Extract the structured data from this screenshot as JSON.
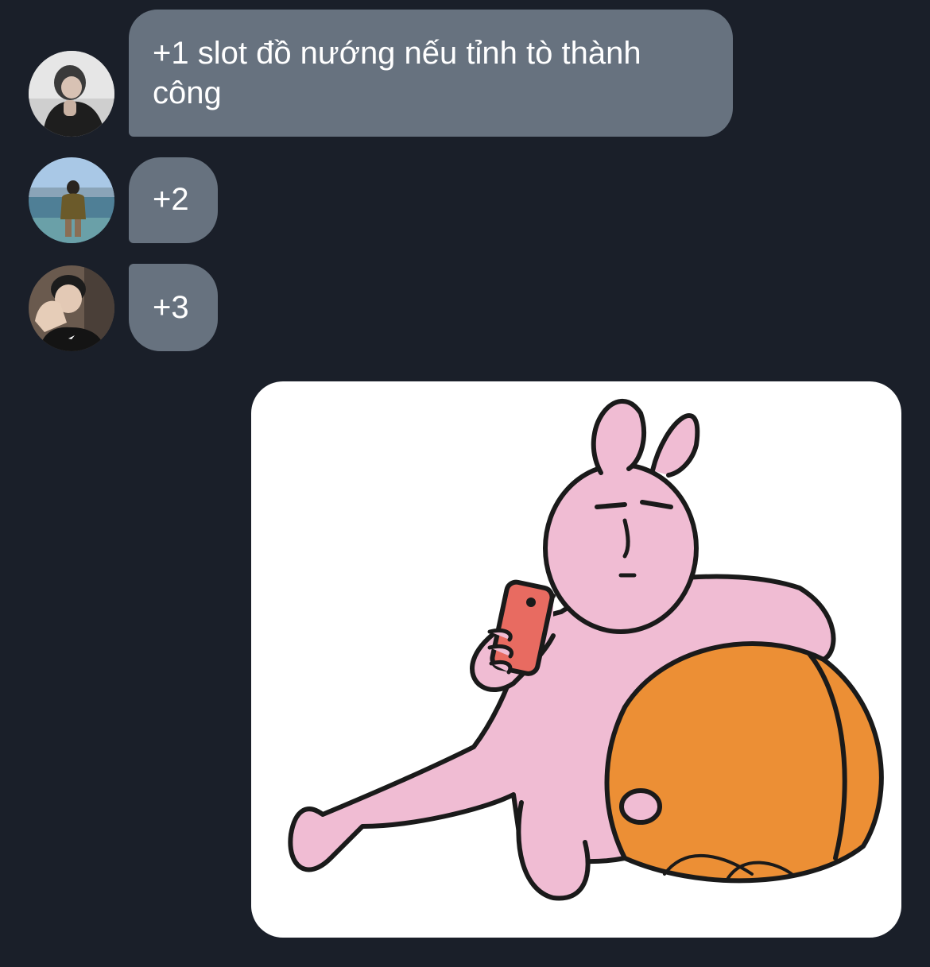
{
  "messages": [
    {
      "sender": "avatar-1",
      "text": "+1 slot đồ nướng nếu tỉnh tò thành công"
    },
    {
      "sender": "avatar-2",
      "text": "+2"
    },
    {
      "sender": "avatar-3",
      "text": "+3"
    }
  ],
  "sticker": {
    "icon": "pink-rabbit-with-phone-sticker"
  },
  "colors": {
    "background": "#1a1f29",
    "bubble": "#67727f",
    "bubble_text": "#ffffff",
    "rabbit_pink": "#f0bcd3",
    "cushion_orange": "#ec8f35",
    "phone_red": "#e86b61"
  }
}
